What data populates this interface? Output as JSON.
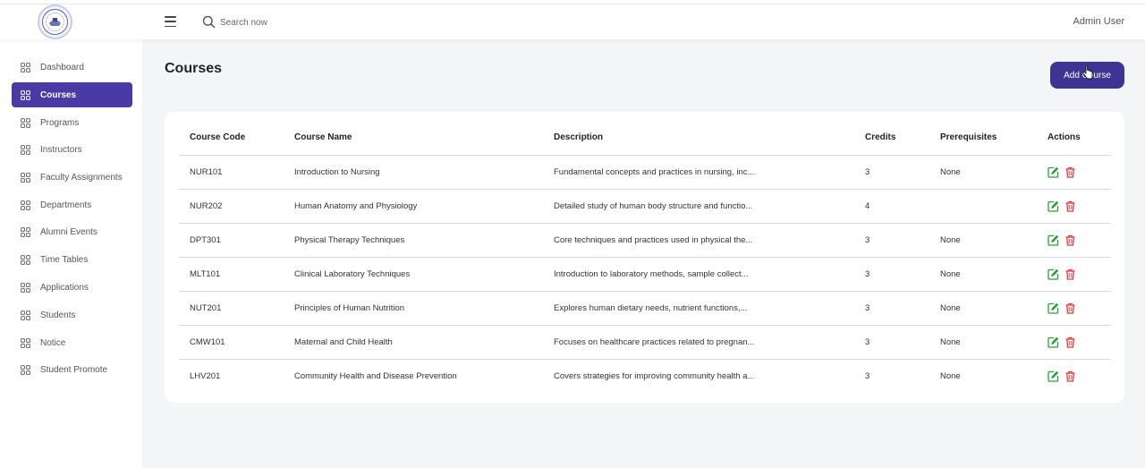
{
  "header": {
    "search_placeholder": "Search now",
    "user_name": "Admin User"
  },
  "sidebar": {
    "items": [
      {
        "label": "Dashboard",
        "active": false
      },
      {
        "label": "Courses",
        "active": true
      },
      {
        "label": "Programs",
        "active": false
      },
      {
        "label": "Instructors",
        "active": false
      },
      {
        "label": "Faculty Assignments",
        "active": false
      },
      {
        "label": "Departments",
        "active": false
      },
      {
        "label": "Alumni Events",
        "active": false
      },
      {
        "label": "Time Tables",
        "active": false
      },
      {
        "label": "Applications",
        "active": false
      },
      {
        "label": "Students",
        "active": false
      },
      {
        "label": "Notice",
        "active": false
      },
      {
        "label": "Student Promote",
        "active": false
      }
    ]
  },
  "main": {
    "title": "Courses",
    "add_button_label": "Add Course"
  },
  "table": {
    "headers": [
      "Course Code",
      "Course Name",
      "Description",
      "Credits",
      "Prerequisites",
      "Actions"
    ],
    "rows": [
      {
        "code": "NUR101",
        "name": "Introduction to Nursing",
        "description": "Fundamental concepts and practices in nursing, inc...",
        "credits": "3",
        "prerequisites": "None"
      },
      {
        "code": "NUR202",
        "name": "Human Anatomy and Physiology",
        "description": "Detailed study of human body structure and functio...",
        "credits": "4",
        "prerequisites": ""
      },
      {
        "code": "DPT301",
        "name": "Physical Therapy Techniques",
        "description": "Core techniques and practices used in physical the...",
        "credits": "3",
        "prerequisites": "None"
      },
      {
        "code": "MLT101",
        "name": "Clinical Laboratory Techniques",
        "description": "Introduction to laboratory methods, sample collect...",
        "credits": "3",
        "prerequisites": "None"
      },
      {
        "code": "NUT201",
        "name": "Principles of Human Nutrition",
        "description": "Explores human dietary needs, nutrient functions,...",
        "credits": "3",
        "prerequisites": "None"
      },
      {
        "code": "CMW101",
        "name": "Maternal and Child Health",
        "description": "Focuses on healthcare practices related to pregnan...",
        "credits": "3",
        "prerequisites": "None"
      },
      {
        "code": "LHV201",
        "name": "Community Health and Disease Prevention",
        "description": "Covers strategies for improving community health a...",
        "credits": "3",
        "prerequisites": "None"
      }
    ]
  },
  "icons": {
    "menu": "hamburger-menu-icon",
    "search": "search-icon",
    "nav": "grid-icon",
    "edit": "edit-icon",
    "delete": "trash-icon",
    "cursor": "mouse-pointer-icon"
  },
  "colors": {
    "primary": "#4a3aa6",
    "button": "#3f3494",
    "edit": "#2e9e3e",
    "delete": "#e03a3a",
    "background": "#f4f5f7"
  }
}
